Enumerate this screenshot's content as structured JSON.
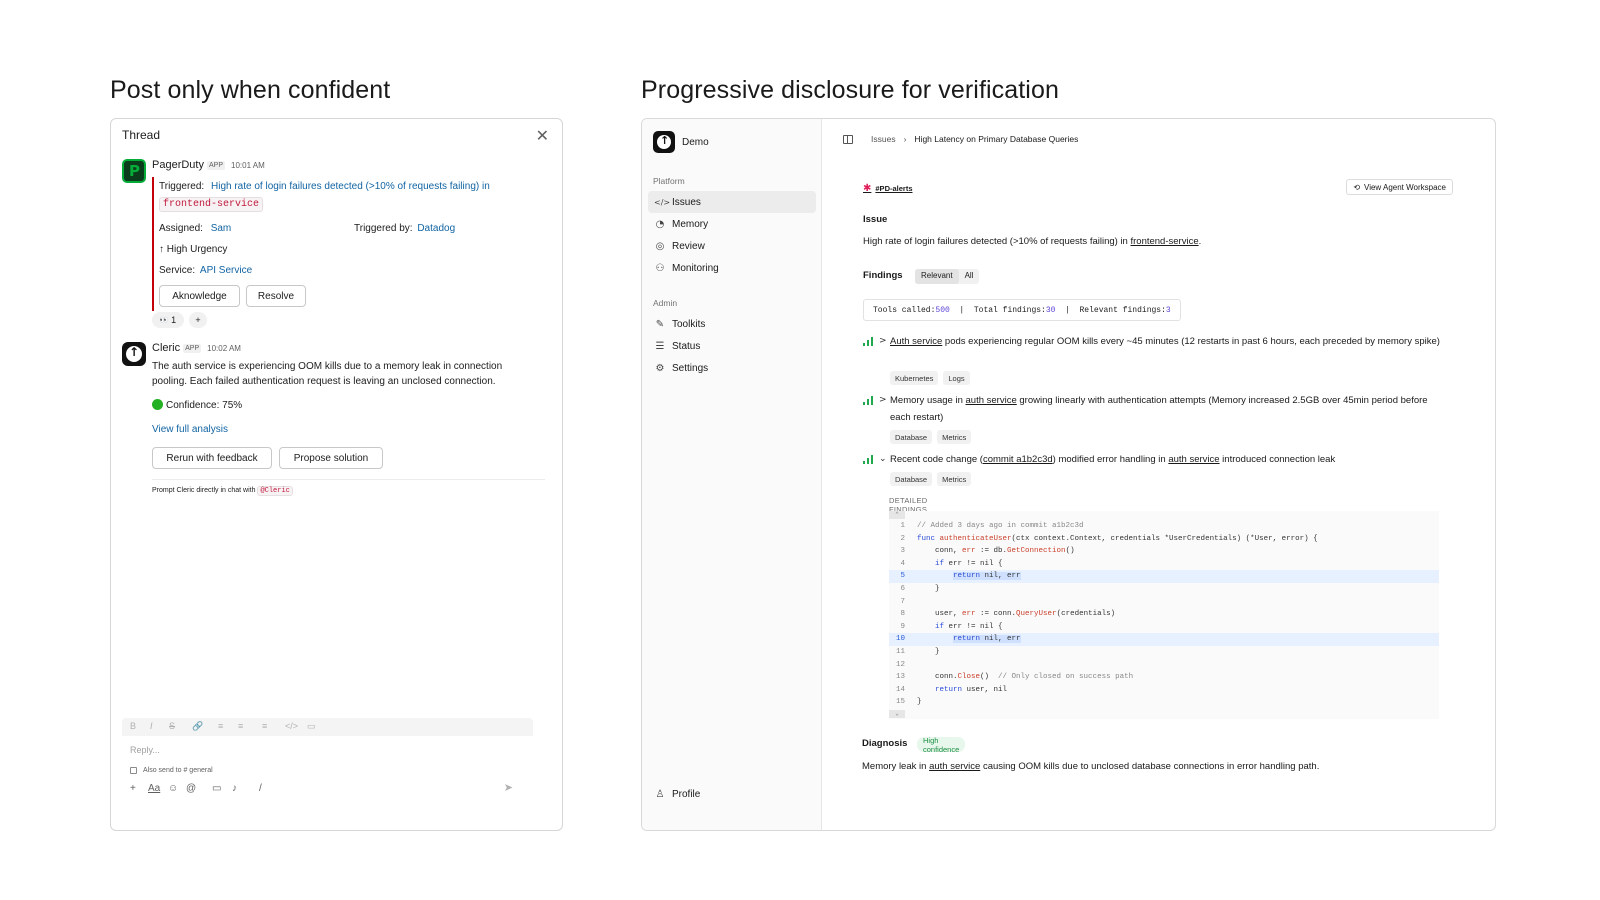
{
  "headings": {
    "left": "Post only when confident",
    "right": "Progressive disclosure for verification"
  },
  "thread": {
    "title": "Thread",
    "pagerduty": {
      "name": "PagerDuty",
      "app_tag": "APP",
      "time": "10:01 AM",
      "triggered_label": "Triggered:",
      "triggered_text": "High rate of login failures detected (>10% of requests failing) in",
      "service_code": "frontend-service",
      "assigned_label": "Assigned:",
      "assigned_value": "Sam",
      "triggered_by_label": "Triggered by:",
      "triggered_by_value": "Datadog",
      "urgency": "↑ High Urgency",
      "service_label": "Service:",
      "service_value": "API Service",
      "ack_button": "Aknowledge",
      "resolve_button": "Resolve",
      "reaction_emoji": "👀",
      "reaction_count": "1",
      "add_reaction": "+"
    },
    "cleric": {
      "name": "Cleric",
      "app_tag": "APP",
      "time": "10:02 AM",
      "message": "The auth service is experiencing OOM kills due to a memory leak in connection pooling. Each failed authentication request is leaving an unclosed connection.",
      "confidence": "Confidence: 75%",
      "view_link": "View full analysis",
      "rerun_button": "Rerun with feedback",
      "propose_button": "Propose solution",
      "prompt_hint": "Prompt Cleric directly in chat with",
      "mention": "@Cleric"
    },
    "composer": {
      "placeholder": "Reply...",
      "also_send": "Also send to # general",
      "format_icons": [
        "B",
        "I",
        "S",
        "🔗",
        "≡",
        "≡",
        "≡",
        "</>",
        "▭"
      ],
      "tool_icons": [
        "+",
        "Aa",
        "☺",
        "@",
        "▭",
        "♪",
        "/"
      ],
      "send": "➤"
    }
  },
  "app": {
    "org": "Demo",
    "platform_label": "Platform",
    "platform_items": [
      {
        "icon": "</>",
        "label": "Issues",
        "active": true
      },
      {
        "icon": "◔",
        "label": "Memory",
        "active": false
      },
      {
        "icon": "◎",
        "label": "Review",
        "active": false
      },
      {
        "icon": "⚇",
        "label": "Monitoring",
        "active": false
      }
    ],
    "admin_label": "Admin",
    "admin_items": [
      {
        "icon": "✎",
        "label": "Toolkits"
      },
      {
        "icon": "☰",
        "label": "Status"
      },
      {
        "icon": "⚙",
        "label": "Settings"
      }
    ],
    "profile": "Profile",
    "breadcrumb": {
      "parent": "Issues",
      "current": "High Latency on Primary Database Queries"
    },
    "channel": "#PD-alerts",
    "workspace_button": "View Agent Workspace",
    "issue_label": "Issue",
    "issue_text": "High rate of login failures detected (>10% of requests failing) in",
    "issue_link": "frontend-service",
    "findings_label": "Findings",
    "tabs": [
      "Relevant",
      "All"
    ],
    "stats": {
      "tools_label": "Tools called:",
      "tools": "500",
      "total_label": "Total findings:",
      "total": "30",
      "relevant_label": "Relevant findings:",
      "relevant": "3"
    },
    "findings": [
      {
        "chevron": ">",
        "link": "Auth service",
        "text": " pods experiencing regular OOM kills every ~45 minutes (12 restarts in past 6 hours, each preceded by memory spike)",
        "tags": [
          "Kubernetes",
          "Logs"
        ]
      },
      {
        "chevron": ">",
        "pre": "Memory usage in ",
        "link": "auth service",
        "text": " growing linearly with authentication attempts (Memory increased 2.5GB over 45min period before each restart)",
        "tags": [
          "Database",
          "Metrics"
        ]
      },
      {
        "chevron": "⌄",
        "pre": "Recent code change (",
        "link": "commit a1b2c3d",
        "mid": ") modified error handling in ",
        "link2": "auth service",
        "text": " introduced connection leak",
        "tags": [
          "Database",
          "Metrics"
        ]
      }
    ],
    "detailed_label": "DETAILED FINDINGS",
    "code_lines": [
      {
        "n": "1",
        "code": "// Added 3 days ago in commit a1b2c3d"
      },
      {
        "n": "2",
        "code": "func authenticateUser(ctx context.Context, credentials *UserCredentials) (*User, error) {"
      },
      {
        "n": "3",
        "code": "    conn, err := db.GetConnection()"
      },
      {
        "n": "4",
        "code": "    if err != nil {"
      },
      {
        "n": "5",
        "code": "        return nil, err"
      },
      {
        "n": "6",
        "code": "    }"
      },
      {
        "n": "7",
        "code": ""
      },
      {
        "n": "8",
        "code": "    user, err := conn.QueryUser(credentials)"
      },
      {
        "n": "9",
        "code": "    if err != nil {"
      },
      {
        "n": "10",
        "code": "        return nil, err"
      },
      {
        "n": "11",
        "code": "    }"
      },
      {
        "n": "12",
        "code": ""
      },
      {
        "n": "13",
        "code": "    conn.Close()  // Only closed on success path"
      },
      {
        "n": "14",
        "code": "    return user, nil"
      },
      {
        "n": "15",
        "code": "}"
      }
    ],
    "diagnosis_label": "Diagnosis",
    "diagnosis_badge": "High confidence",
    "diagnosis_pre": "Memory leak in",
    "diagnosis_link": "auth service",
    "diagnosis_text": "causing OOM kills due to unclosed database connections in error handling path."
  }
}
